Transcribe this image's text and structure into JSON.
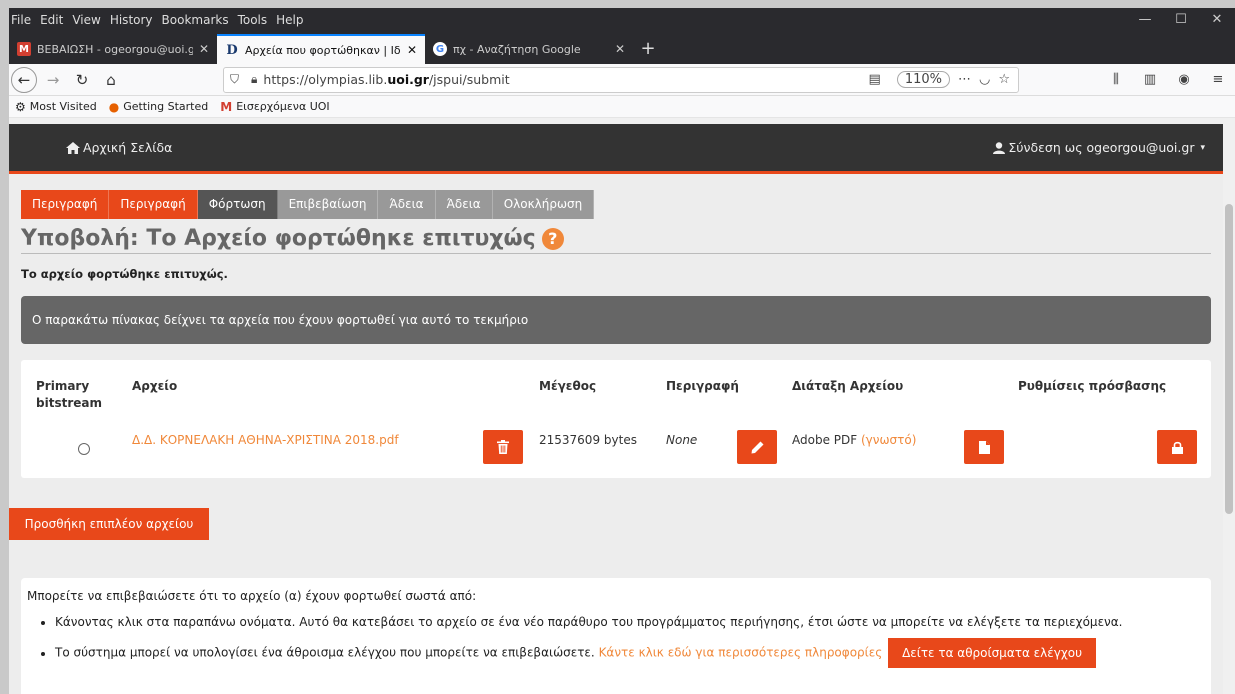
{
  "menu": [
    "File",
    "Edit",
    "View",
    "History",
    "Bookmarks",
    "Tools",
    "Help"
  ],
  "window_controls": [
    "—",
    "☐",
    "✕"
  ],
  "tabs": [
    {
      "label": "ΒΕΒΑΙΩΣΗ - ogeorgou@uoi.gr",
      "favicon": "M",
      "active": false
    },
    {
      "label": "Αρχεία που φορτώθηκαν | Ιδρ",
      "favicon": "D",
      "active": true
    },
    {
      "label": "πχ - Αναζήτηση Google",
      "favicon": "G",
      "active": false
    }
  ],
  "urlbar": {
    "prefix": "https://olympias.lib.",
    "host": "uoi.gr",
    "suffix": "/jspui/submit",
    "zoom": "110%"
  },
  "bookmarks": [
    "Most Visited",
    "Getting Started",
    "Εισερχόμενα UOI"
  ],
  "site_nav": {
    "home": "Αρχική Σελίδα",
    "login": "Σύνδεση ως ogeorgou@uoi.gr"
  },
  "steps": [
    {
      "label": "Περιγραφή",
      "state": "done"
    },
    {
      "label": "Περιγραφή",
      "state": "done"
    },
    {
      "label": "Φόρτωση",
      "state": "current"
    },
    {
      "label": "Επιβεβαίωση",
      "state": "todo"
    },
    {
      "label": "Άδεια",
      "state": "todo"
    },
    {
      "label": "Άδεια",
      "state": "todo"
    },
    {
      "label": "Ολοκλήρωση",
      "state": "todo"
    }
  ],
  "page_title": "Υποβολή: Το Αρχείο φορτώθηκε επιτυχώς",
  "success_msg": "Το αρχείο φορτώθηκε επιτυχώς.",
  "info_bar": "Ο παρακάτω πίνακας δείχνει τα αρχεία που έχουν φορτωθεί για αυτό το τεκμήριο",
  "table": {
    "headers": {
      "primary": "Primary",
      "primary2": "bitstream",
      "file": "Αρχείο",
      "size": "Μέγεθος",
      "description": "Περιγραφή",
      "format": "Διάταξη Αρχείου",
      "access": "Ρυθμίσεις πρόσβασης"
    },
    "row": {
      "file": "Δ.Δ. ΚΟΡΝΕΛΑΚΗ ΑΘΗΝΑ-ΧΡΙΣΤΙΝΑ 2018.pdf",
      "size": "21537609 bytes",
      "description": "None",
      "format": "Adobe PDF",
      "format_known": "(γνωστό)"
    }
  },
  "add_button": "Προσθήκη επιπλέον αρχείου",
  "note": {
    "intro": "Μπορείτε να επιβεβαιώσετε ότι το αρχείο (α) έχουν φορτωθεί σωστά από:",
    "bullet1": "Κάνοντας κλικ στα παραπάνω ονόματα. Αυτό θα κατεβάσει το αρχείο σε ένα νέο παράθυρο του προγράμματος περιήγησης, έτσι ώστε να μπορείτε να ελέγξετε τα περιεχόμενα.",
    "bullet2": "Το σύστημα μπορεί να υπολογίσει ένα άθροισμα ελέγχου που μπορείτε να επιβεβαιώσετε.",
    "more_link": "Κάντε κλικ εδώ για περισσότερες πληροφορίες",
    "checksum_button": "Δείτε τα αθροίσματα ελέγχου"
  },
  "colors": {
    "accent": "#e8481a",
    "link": "#f0883a",
    "nav_dark": "#333333",
    "step_current": "#555555",
    "step_todo": "#999999"
  }
}
